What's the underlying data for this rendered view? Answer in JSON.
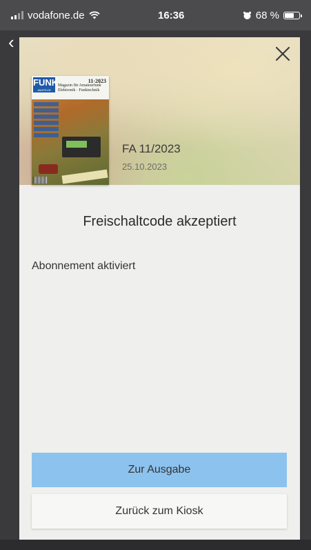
{
  "status_bar": {
    "carrier": "vodafone.de",
    "time": "16:36",
    "battery_percent_label": "68 %",
    "battery_level": 0.68
  },
  "modal": {
    "issue": {
      "title": "FA 11/2023",
      "date": "25.10.2023",
      "cover": {
        "logo": "FUNK",
        "logo_sub": "AMATEUR",
        "issue_label": "11·2023",
        "tagline": "Magazin für Amateurfunk Elektronik · Funktechnik"
      }
    },
    "heading": "Freischaltcode akzeptiert",
    "message": "Abonnement aktiviert",
    "primary_button": "Zur Ausgabe",
    "secondary_button": "Zurück zum Kiosk"
  },
  "colors": {
    "primary_button": "#8cc2ee",
    "modal_background": "#efefed",
    "backdrop": "#3a3a3c"
  },
  "icons": {
    "signal": "signal-bars-icon",
    "wifi": "wifi-icon",
    "alarm": "alarm-icon",
    "battery": "battery-icon",
    "close": "close-icon",
    "back": "chevron-left-icon"
  }
}
